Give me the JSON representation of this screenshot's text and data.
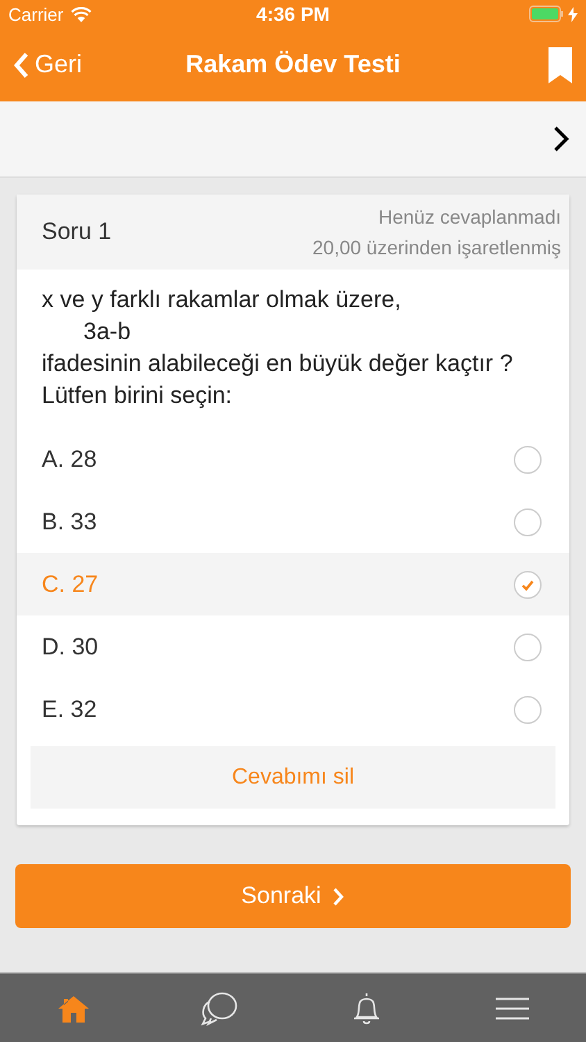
{
  "status_bar": {
    "carrier": "Carrier",
    "time": "4:36 PM",
    "charging": true
  },
  "nav": {
    "back": "Geri",
    "title": "Rakam Ödev Testi"
  },
  "question": {
    "title": "Soru 1",
    "status": "Henüz cevaplanmadı",
    "grade": "20,00 üzerinden işaretlenmiş",
    "lines": [
      {
        "text": "x ve y farklı rakamlar olmak üzere,",
        "indented": false
      },
      {
        "text": "3a-b",
        "indented": true
      },
      {
        "text": "ifadesinin alabileceği en büyük değer kaçtır ?",
        "indented": false
      },
      {
        "text": "Lütfen birini seçin:",
        "indented": false
      }
    ],
    "options": [
      {
        "label": "A. 28",
        "selected": false
      },
      {
        "label": "B. 33",
        "selected": false
      },
      {
        "label": "C. 27",
        "selected": true
      },
      {
        "label": "D. 30",
        "selected": false
      },
      {
        "label": "E. 32",
        "selected": false
      }
    ],
    "clear_button": "Cevabımı sil"
  },
  "next_button": "Sonraki",
  "tab_bar": [
    {
      "kind": "home",
      "selected": true
    },
    {
      "kind": "chat",
      "selected": false
    },
    {
      "kind": "bell",
      "selected": false
    },
    {
      "kind": "menu",
      "selected": false
    }
  ]
}
